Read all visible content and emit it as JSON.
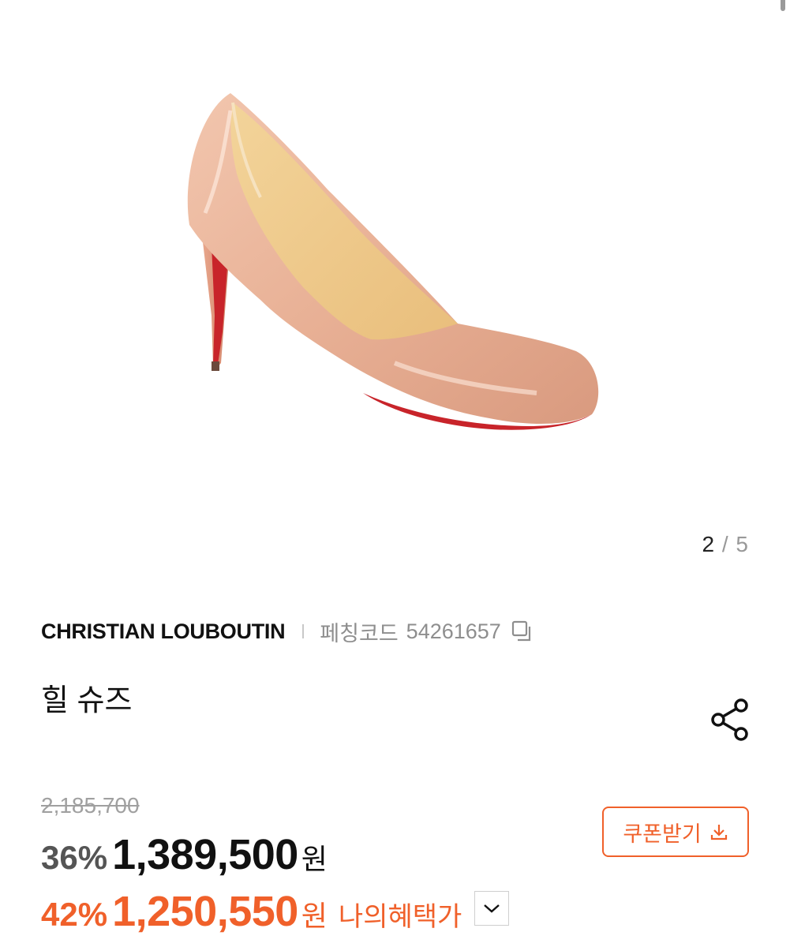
{
  "gallery": {
    "current": "2",
    "separator": "/",
    "total": "5"
  },
  "product": {
    "brand": "CHRISTIAN LOUBOUTIN",
    "code_label": "페칭코드",
    "code_value": "54261657",
    "name": "힐 슈즈"
  },
  "pricing": {
    "original": "2,185,700",
    "sale_discount": "36%",
    "sale_amount": "1,389,500",
    "currency": "원",
    "my_discount": "42%",
    "my_amount": "1,250,550",
    "my_label": "나의혜택가"
  },
  "actions": {
    "coupon_label": "쿠폰받기"
  },
  "icons": {
    "copy": "copy-icon",
    "share": "share-icon",
    "download": "download-icon",
    "chevron": "chevron-down-icon"
  },
  "colors": {
    "accent": "#f0602a",
    "muted": "#8e8e8e",
    "text": "#111111"
  }
}
